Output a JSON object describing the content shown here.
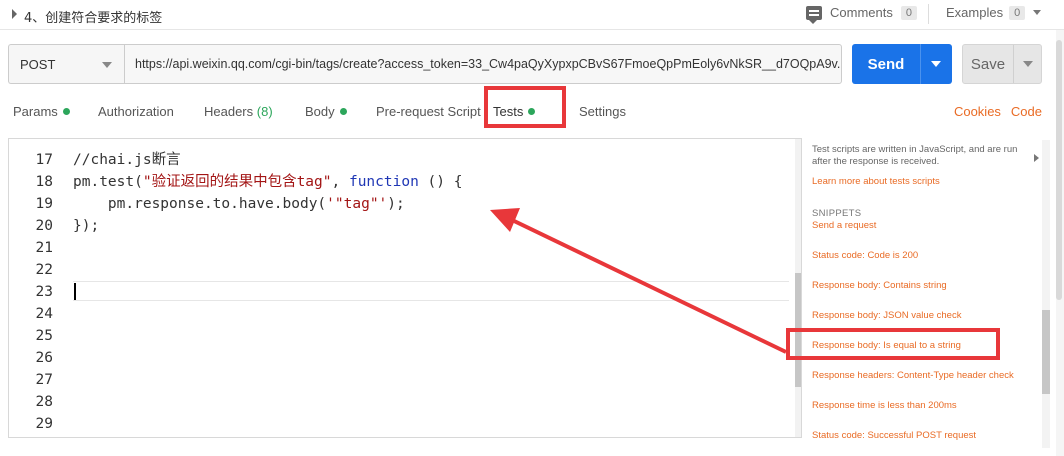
{
  "header": {
    "title": "4、创建符合要求的标签",
    "comments_label": "Comments",
    "comments_count": "0",
    "examples_label": "Examples",
    "examples_count": "0"
  },
  "request": {
    "method": "POST",
    "url": "https://api.weixin.qq.com/cgi-bin/tags/create?access_token=33_Cw4paQyXypxpCBvS67FmoeQpPmEoly6vNkSR__d7OQpA9v...",
    "send_label": "Send",
    "save_label": "Save"
  },
  "tabs": {
    "params": "Params",
    "authorization": "Authorization",
    "headers": "Headers",
    "headers_count": "(8)",
    "body": "Body",
    "prerequest": "Pre-request Script",
    "tests": "Tests",
    "settings": "Settings",
    "cookies": "Cookies",
    "code": "Code"
  },
  "editor": {
    "lines": [
      {
        "num": "17",
        "code": "//chai.js断言"
      },
      {
        "num": "18",
        "code_a": "pm.test(",
        "code_b": "\"验证返回的结果中包含tag\"",
        "code_c": ", ",
        "code_d": "function",
        "code_e": " () {"
      },
      {
        "num": "19",
        "code_a": "    pm.response.to.have.body(",
        "code_b": "'\"tag\"'",
        "code_c": ");"
      },
      {
        "num": "20",
        "code": "});"
      },
      {
        "num": "21"
      },
      {
        "num": "22"
      },
      {
        "num": "23"
      },
      {
        "num": "24"
      },
      {
        "num": "25"
      },
      {
        "num": "26"
      },
      {
        "num": "27"
      },
      {
        "num": "28"
      },
      {
        "num": "29"
      }
    ]
  },
  "sidebar": {
    "description": "Test scripts are written in JavaScript, and are run after the response is received.",
    "learn_more": "Learn more about tests scripts",
    "snippets_heading": "SNIPPETS",
    "snippets": [
      "Send a request",
      "Status code: Code is 200",
      "Response body: Contains string",
      "Response body: JSON value check",
      "Response body: Is equal to a string",
      "Response headers: Content-Type header check",
      "Response time is less than 200ms",
      "Status code: Successful POST request"
    ]
  },
  "colors": {
    "accent_orange": "#e96b25",
    "send_blue": "#1a73e8",
    "annotation_red": "#e8373a",
    "status_green": "#2ca65b"
  }
}
